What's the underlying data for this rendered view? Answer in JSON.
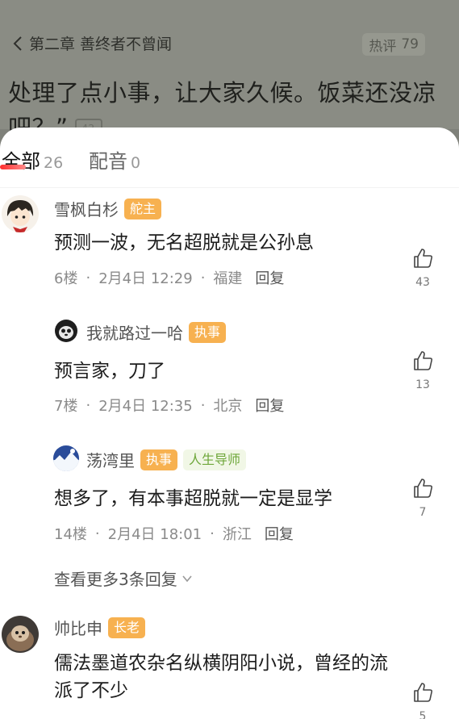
{
  "header": {
    "chapter_title": "第二章 善终者不曾闻",
    "hot_label": "热评",
    "hot_count": "79",
    "chapter_text": "处理了点小事，让大家久候。饭菜还没凉吧？”",
    "mini_badge": "42"
  },
  "tabs": [
    {
      "label": "全部",
      "count": "26"
    },
    {
      "label": "配音",
      "count": "0"
    }
  ],
  "comments": [
    {
      "user": "雪枫白杉",
      "badges": [
        "舵主"
      ],
      "text": "预测一波，无名超脱就是公孙息",
      "floor": "6楼",
      "date": "2月4日 12:29",
      "location": "福建",
      "reply": "回复",
      "likes": "43"
    },
    {
      "user": "我就路过一哈",
      "badges": [
        "执事"
      ],
      "text": "预言家，刀了",
      "floor": "7楼",
      "date": "2月4日 12:35",
      "location": "北京",
      "reply": "回复",
      "likes": "13"
    },
    {
      "user": "荡湾里",
      "badges": [
        "执事",
        "人生导师"
      ],
      "text": "想多了，有本事超脱就一定是显学",
      "floor": "14楼",
      "date": "2月4日 18:01",
      "location": "浙江",
      "reply": "回复",
      "likes": "7"
    },
    {
      "user": "帅比申",
      "badges": [
        "长老"
      ],
      "text": "儒法墨道农杂名纵横阴阳小说，曾经的流派了不少",
      "floor": "",
      "date": "",
      "location": "",
      "reply": "",
      "likes": "5"
    }
  ],
  "more_replies": "查看更多3条回复",
  "colors": {
    "accent": "#ff2f2f",
    "badge_orange": "#f7b150",
    "badge_green_text": "#6ea73a"
  }
}
